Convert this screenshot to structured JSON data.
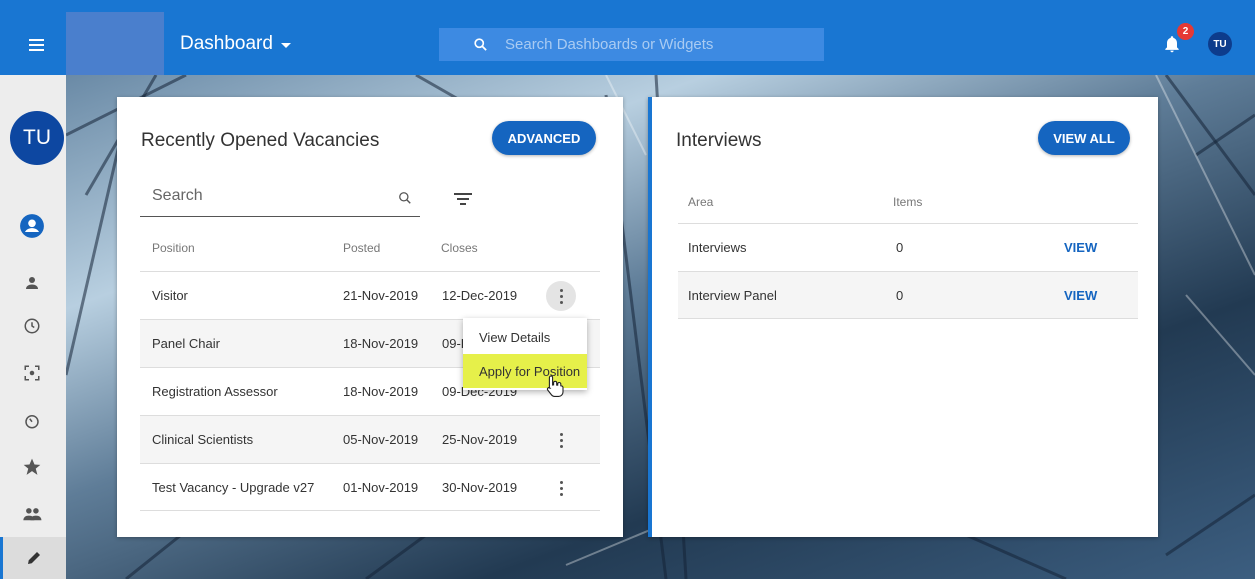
{
  "header": {
    "title": "Dashboard",
    "search_placeholder": "Search Dashboards or Widgets",
    "notification_count": "2",
    "user_initials": "TU"
  },
  "sidebar": {
    "user_initials": "TU",
    "items": [
      "account-circle-icon",
      "person-icon",
      "clock-icon",
      "focus-icon",
      "timer-icon",
      "star-icon",
      "group-icon",
      "pencil-icon"
    ]
  },
  "vacancies": {
    "title": "Recently Opened Vacancies",
    "advanced_label": "ADVANCED",
    "search_placeholder": "Search",
    "columns": [
      "Position",
      "Posted",
      "Closes"
    ],
    "rows": [
      {
        "position": "Visitor",
        "posted": "21-Nov-2019",
        "closes": "12-Dec-2019"
      },
      {
        "position": "Panel Chair",
        "posted": "18-Nov-2019",
        "closes": "09-Dec-2019"
      },
      {
        "position": "Registration Assessor",
        "posted": "18-Nov-2019",
        "closes": "09-Dec-2019"
      },
      {
        "position": "Clinical Scientists",
        "posted": "05-Nov-2019",
        "closes": "25-Nov-2019"
      },
      {
        "position": "Test Vacancy - Upgrade v27",
        "posted": "01-Nov-2019",
        "closes": "30-Nov-2019"
      }
    ],
    "menu": [
      "View Details",
      "Apply for Position"
    ]
  },
  "interviews": {
    "title": "Interviews",
    "view_all_label": "VIEW ALL",
    "columns": [
      "Area",
      "Items"
    ],
    "rows": [
      {
        "area": "Interviews",
        "items": "0",
        "action": "VIEW"
      },
      {
        "area": "Interview Panel",
        "items": "0",
        "action": "VIEW"
      }
    ]
  },
  "colors": {
    "primary": "#1976d2",
    "button": "#1565c0",
    "highlight": "#e6f04a",
    "badge": "#e53935"
  }
}
